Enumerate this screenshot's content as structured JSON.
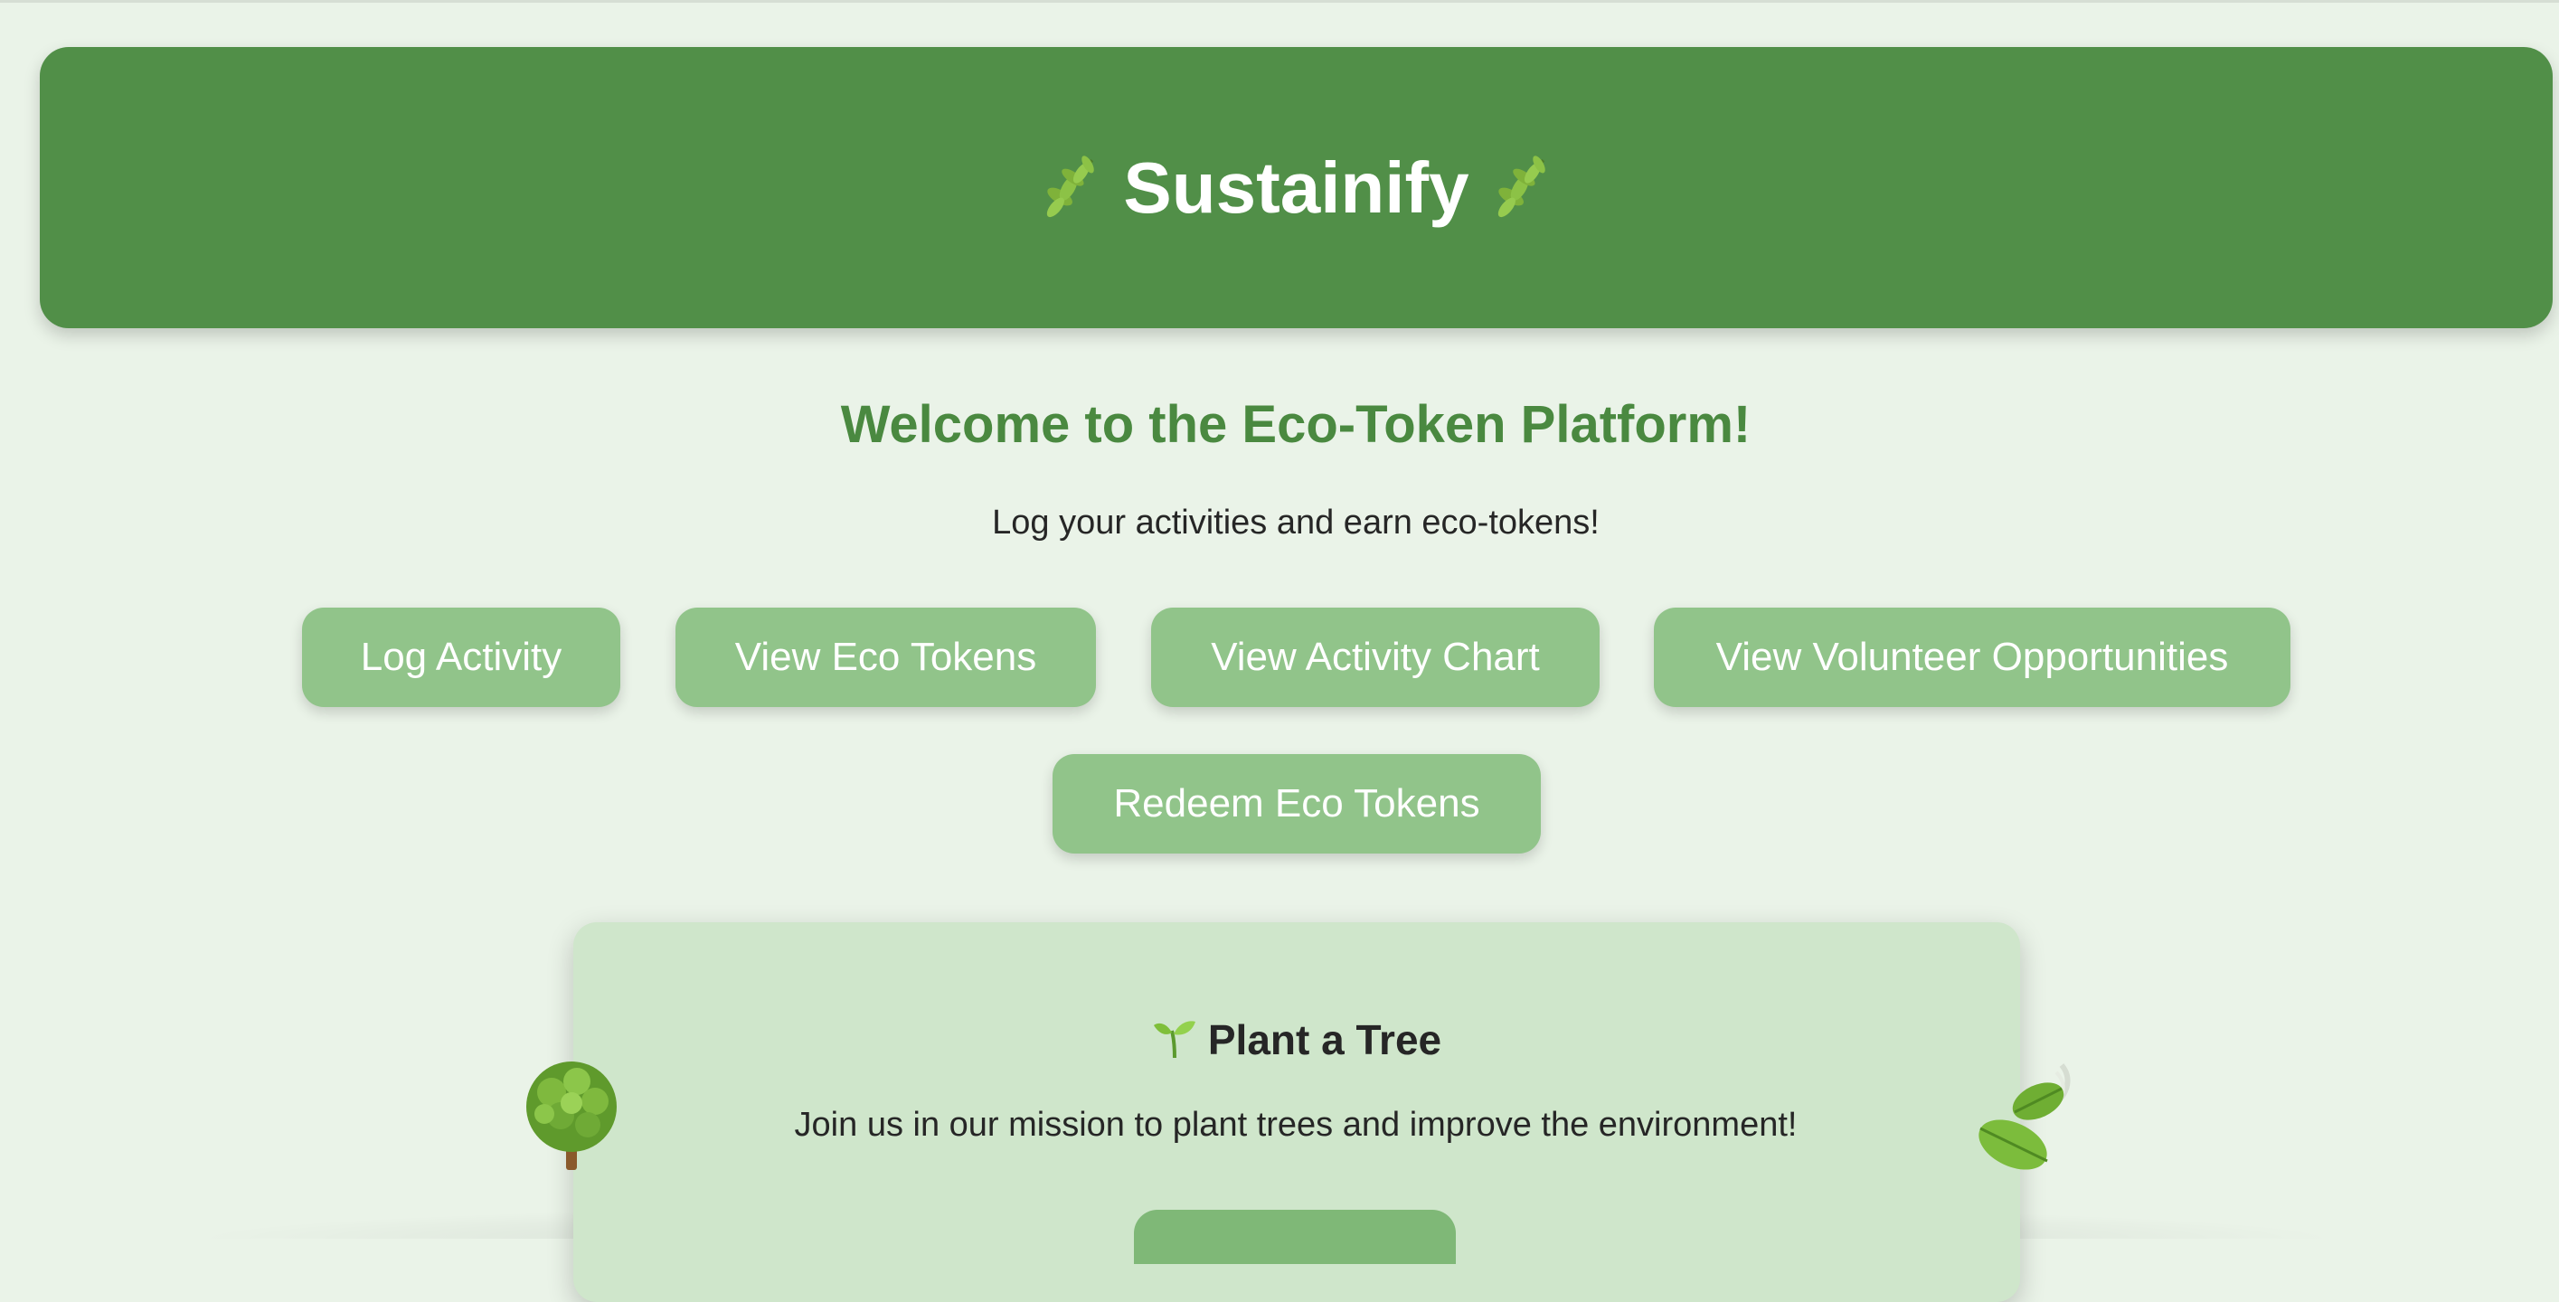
{
  "header": {
    "title": "Sustainify",
    "left_icon": "herb-icon",
    "right_icon": "herb-icon",
    "background_color": "#518f48"
  },
  "welcome": {
    "title": "Welcome to the Eco-Token Platform!",
    "subtitle": "Log your activities and earn eco-tokens!"
  },
  "nav": {
    "log_activity": "Log Activity",
    "view_eco_tokens": "View Eco Tokens",
    "view_activity_chart": "View Activity Chart",
    "view_volunteer_opportunities": "View Volunteer Opportunities",
    "redeem_eco_tokens": "Redeem Eco Tokens",
    "button_color": "#91c48a"
  },
  "plant_card": {
    "title": "Plant a Tree",
    "title_icon": "seedling-icon",
    "description": "Join us in our mission to plant trees and improve the environment!",
    "left_icon": "tree-icon",
    "right_icon": "falling-leaf-icon",
    "background_color": "#cfe6cb"
  }
}
